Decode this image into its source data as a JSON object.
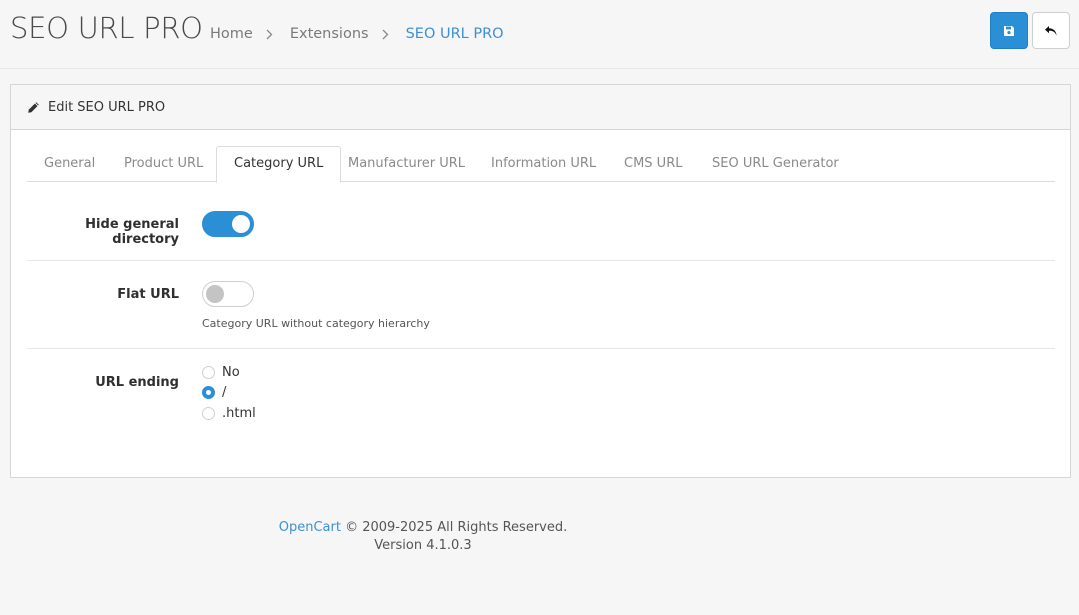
{
  "header": {
    "title": "SEO URL PRO",
    "breadcrumb": [
      {
        "label": "Home"
      },
      {
        "label": "Extensions"
      },
      {
        "label": "SEO URL PRO"
      }
    ],
    "save_icon": "save-icon",
    "back_icon": "back-icon"
  },
  "card": {
    "title": "Edit SEO URL PRO",
    "icon": "pencil-icon"
  },
  "tabs": [
    {
      "label": "General"
    },
    {
      "label": "Product URL"
    },
    {
      "label": "Category URL",
      "active": true
    },
    {
      "label": "Manufacturer URL"
    },
    {
      "label": "Information URL"
    },
    {
      "label": "CMS URL"
    },
    {
      "label": "SEO URL Generator"
    }
  ],
  "form": {
    "hide_general_directory": {
      "label": "Hide general directory",
      "enabled": true
    },
    "flat_url": {
      "label": "Flat URL",
      "enabled": false,
      "help": "Category URL without category hierarchy"
    },
    "url_ending": {
      "label": "URL ending",
      "options": [
        "No",
        "/",
        ".html"
      ],
      "selected": "/"
    }
  },
  "footer": {
    "brand": "OpenCart",
    "copyright": "© 2009-2025 All Rights Reserved.",
    "version": "Version 4.1.0.3"
  },
  "colors": {
    "accent": "#2b8fd6",
    "link": "#3f8fd2"
  }
}
